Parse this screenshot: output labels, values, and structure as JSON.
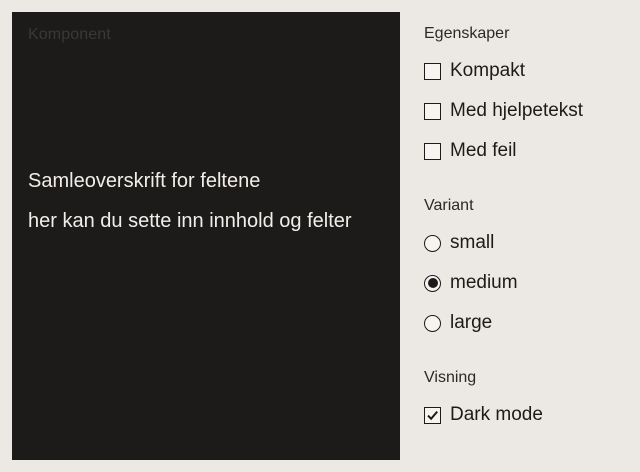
{
  "preview": {
    "label": "Komponent",
    "legend": "Samleoverskrift for feltene",
    "content": "her kan du sette inn innhold og felter"
  },
  "properties": {
    "title": "Egenskaper",
    "options": [
      {
        "label": "Kompakt",
        "checked": false
      },
      {
        "label": "Med hjelpetekst",
        "checked": false
      },
      {
        "label": "Med feil",
        "checked": false
      }
    ]
  },
  "variant": {
    "title": "Variant",
    "options": [
      {
        "label": "small",
        "selected": false
      },
      {
        "label": "medium",
        "selected": true
      },
      {
        "label": "large",
        "selected": false
      }
    ]
  },
  "view": {
    "title": "Visning",
    "options": [
      {
        "label": "Dark mode",
        "checked": true
      }
    ]
  },
  "colors": {
    "background": "#ece9e4",
    "preview_bg": "#1d1b1a",
    "preview_text": "#f1eeea",
    "control_border": "#1d1b1a"
  }
}
